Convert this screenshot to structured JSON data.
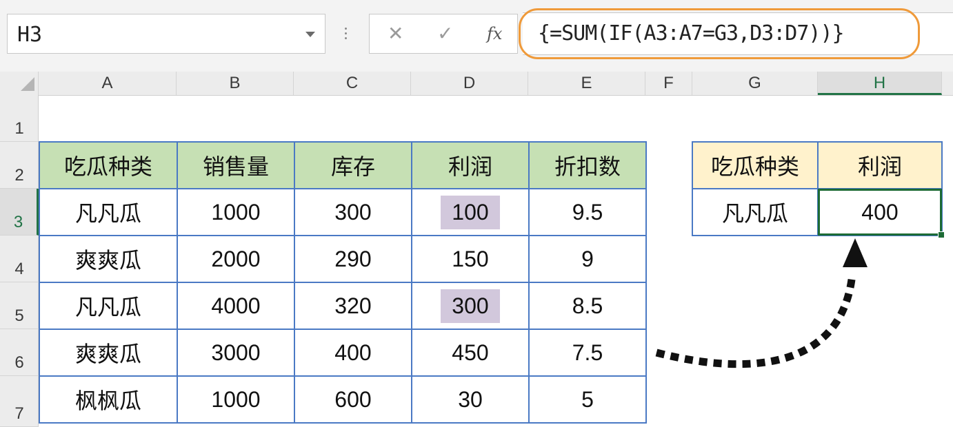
{
  "formula_bar": {
    "name_box": "H3",
    "cancel_icon": "✕",
    "enter_icon": "✓",
    "fx_label": "fx",
    "formula": "{=SUM(IF(A3:A7=G3,D3:D7))}"
  },
  "columns": [
    "A",
    "B",
    "C",
    "D",
    "E",
    "F",
    "G",
    "H"
  ],
  "rows": [
    "1",
    "2",
    "3",
    "4",
    "5",
    "6",
    "7"
  ],
  "table": {
    "headers": [
      "吃瓜种类",
      "销售量",
      "库存",
      "利润",
      "折扣数"
    ],
    "rows": [
      [
        "凡凡瓜",
        "1000",
        "300",
        "100",
        "9.5"
      ],
      [
        "爽爽瓜",
        "2000",
        "290",
        "150",
        "9"
      ],
      [
        "凡凡瓜",
        "4000",
        "320",
        "300",
        "8.5"
      ],
      [
        "爽爽瓜",
        "3000",
        "400",
        "450",
        "7.5"
      ],
      [
        "枫枫瓜",
        "1000",
        "600",
        "30",
        "5"
      ]
    ]
  },
  "lookup": {
    "headers": [
      "吃瓜种类",
      "利润"
    ],
    "key": "凡凡瓜",
    "result": "400"
  },
  "colors": {
    "header_fill": "#c6e0b4",
    "lookup_header_fill": "#fff2cc",
    "highlight_fill": "#d2c8dc",
    "table_border": "#4a79c4",
    "formula_highlight": "#ef9a3a",
    "active_cell_border": "#1d6b35"
  }
}
